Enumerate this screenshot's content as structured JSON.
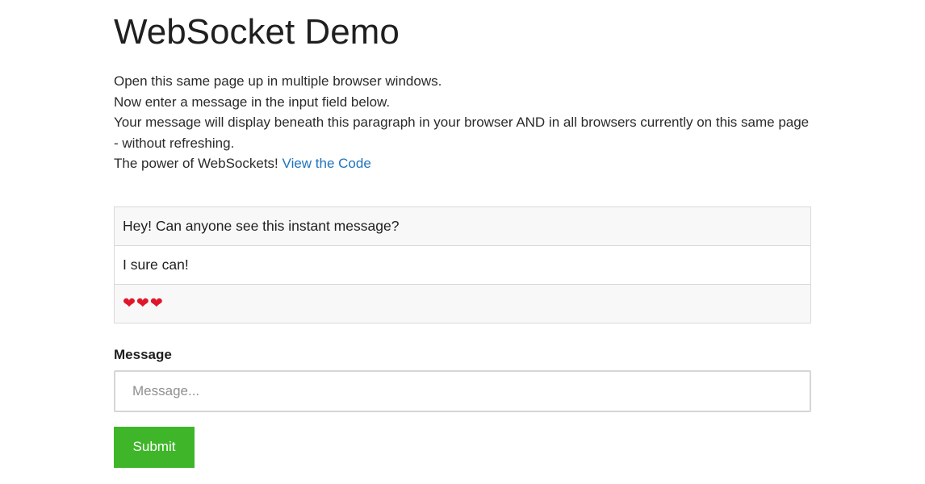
{
  "page": {
    "title": "WebSocket Demo"
  },
  "intro": {
    "line1": "Open this same page up in multiple browser windows.",
    "line2": "Now enter a message in the input field below.",
    "line3": "Your message will display beneath this paragraph in your browser AND in all browsers currently on this same page - without refreshing.",
    "line4_prefix": "The power of WebSockets!",
    "link_text": "View the Code"
  },
  "messages": [
    {
      "text": "Hey! Can anyone see this instant message?"
    },
    {
      "text": "I sure can!"
    },
    {
      "text": "❤️❤️❤️",
      "icons": [
        "heart-icon",
        "heart-icon",
        "heart-icon"
      ]
    }
  ],
  "form": {
    "label": "Message",
    "input_value": "",
    "input_placeholder": "Message...",
    "submit_label": "Submit"
  },
  "colors": {
    "link": "#1e73be",
    "submit_bg": "#3fb62a",
    "row_alt_bg": "#f8f8f8",
    "heart": "#e0162b"
  }
}
